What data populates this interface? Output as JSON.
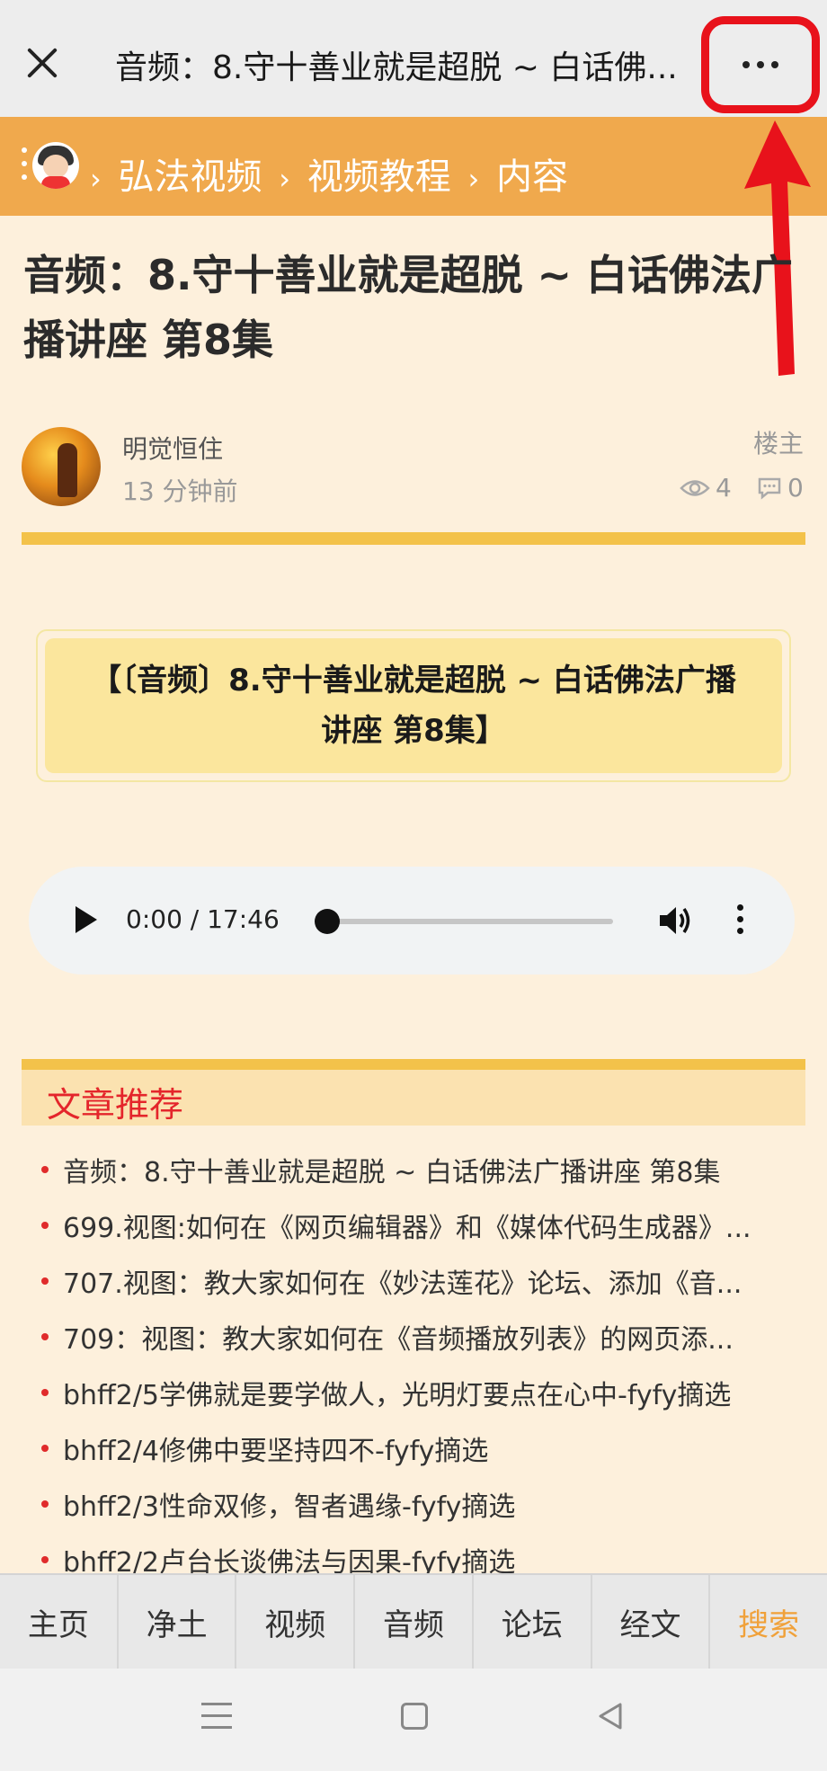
{
  "topbar": {
    "title": "音频：8.守十善业就是超脱 ~ 白话佛...",
    "close_icon": "close-icon",
    "more_icon": "more-dots-icon",
    "highlight_color": "#e8121b"
  },
  "breadcrumb": {
    "items": [
      "弘法视频",
      "视频教程",
      "内容"
    ],
    "separator": "›",
    "bar_color": "#f0a94d"
  },
  "article": {
    "title": "音频：8.守十善业就是超脱 ~ 白话佛法广播讲座 第8集",
    "author": "明觉恒住",
    "time": "13 分钟前",
    "role_badge": "楼主",
    "views": "4",
    "comments": "0",
    "highlight_text": "【〔音频〕8.守十善业就是超脱 ~ 白话佛法广播讲座 第8集】"
  },
  "audio": {
    "time": "0:00 / 17:46",
    "progress": 0
  },
  "recommend": {
    "title": "文章推荐",
    "items": [
      "音频：8.守十善业就是超脱 ~ 白话佛法广播讲座 第8集",
      "699.视图:如何在《网页编辑器》和《媒体代码生成器》...",
      "707.视图：教大家如何在《妙法莲花》论坛、添加《音...",
      "709：视图：教大家如何在《音频播放列表》的网页添...",
      "bhff2/5学佛就是要学做人，光明灯要点在心中-fyfy摘选",
      "bhff2/4修佛中要坚持四不-fyfy摘选",
      "bhff2/3性命双修，智者遇缘-fyfy摘选",
      "bhff2/2卢台长谈佛法与因果-fyfy摘选"
    ]
  },
  "bottom_nav": {
    "items": [
      "主页",
      "净土",
      "视频",
      "音频",
      "论坛",
      "经文",
      "搜索"
    ],
    "active_color": "#f0a13a"
  },
  "system_nav": {
    "icons": [
      "menu-icon",
      "home-icon",
      "back-icon"
    ]
  }
}
